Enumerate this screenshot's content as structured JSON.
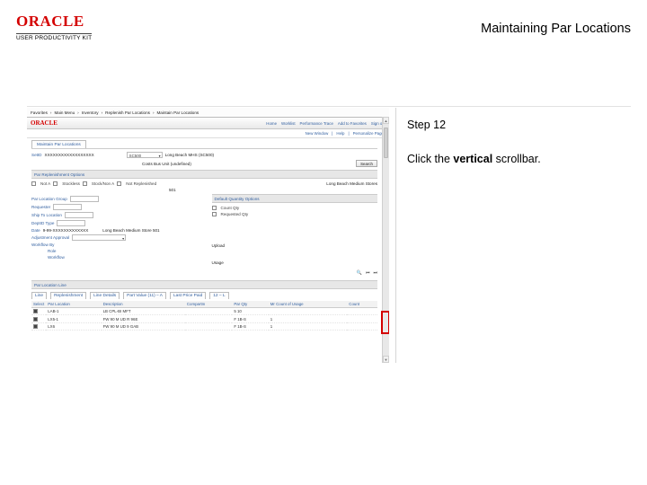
{
  "brand": {
    "logo_word": "ORACLE",
    "sub": "USER PRODUCTIVITY KIT"
  },
  "page_title": "Maintaining Par Locations",
  "instructions": {
    "step_label": "Step 12",
    "text_pre": "Click the ",
    "text_bold": "vertical",
    "text_post": " scrollbar."
  },
  "app": {
    "crumbs": [
      "Favorites",
      "Main Menu",
      "Inventory",
      "Replenish Par Locations",
      "Maintain Par Locations"
    ],
    "top_links": [
      "Home",
      "Worklist",
      "Performance Trace",
      "Add to Favorites",
      "Sign out"
    ],
    "mini_logo": "ORACLE",
    "nav3": [
      "New Window",
      "Help",
      "Personalize Page"
    ],
    "tab": "Maintain Par Locations",
    "header": {
      "setid_label": "SetID",
      "setid_value": "XXXXXXXXXXXXXXXXXX",
      "bu_label": "",
      "bu_value": "SC500",
      "bu_name": "Long Beach MHS (SC500)",
      "gl_label": "",
      "gl_value": "Costs Bus Unit (undefined)",
      "search_btn": "Search"
    },
    "repl_section": "Par Replenishment Options",
    "repl_opts": [
      "Not A",
      "Stockless",
      "Stock/Non A",
      "Not Replenished"
    ],
    "left": [
      {
        "label": "Par Location Group",
        "type": "inp",
        "value": ""
      },
      {
        "label": "Requester",
        "type": "inp",
        "value": ""
      },
      {
        "label": "Ship To Location",
        "type": "inp",
        "value": ""
      },
      {
        "label": "DeptID Type",
        "type": "inp",
        "value": ""
      },
      {
        "label": "Date",
        "type": "text",
        "value": "9-99-XXXXXXXXXXXXX"
      },
      {
        "label": "Adjustment Approval",
        "type": "selinp",
        "value": ""
      },
      {
        "label": "Workflow By",
        "type": "text",
        "value": ""
      },
      {
        "label": "Role",
        "type": "text",
        "value": ""
      },
      {
        "label": "Workflow",
        "type": "text",
        "value": ""
      }
    ],
    "left_extra_text1": "Long Beach Medium Stores",
    "left_extra_text2": "501",
    "left_extra_text3": "Long Beach Medium Store 501",
    "right_section": "Default Quantity Options",
    "right_opts": [
      "Count Qty",
      "Requested Qty"
    ],
    "right_mid1": "Upload",
    "right_mid2": "Usage",
    "line_section": "Par Location Line",
    "line_tabs": [
      "Line",
      "Replenishment",
      "Line Details",
      "Part Value (11) – A",
      "Last Price Paid",
      "12 – L"
    ],
    "table": {
      "cols": [
        "Select",
        "Par Location",
        "Description",
        "Compartm",
        "Par Qty",
        "Mr Count of Usage",
        "Count"
      ],
      "rows": [
        {
          "select": true,
          "loc": "LAB-1",
          "desc": "LB CPL-BI MFT",
          "comp": "",
          "par": "5 10",
          "mr": "",
          "cnt": ""
        },
        {
          "select": true,
          "loc": "LX5-1",
          "desc": "FW 90 M UD R 96E",
          "comp": "",
          "par": "F 1B-S",
          "mr": "1",
          "cnt": ""
        },
        {
          "select": true,
          "loc": "LX6",
          "desc": "FW 90 M UD 9 GAB",
          "comp": "",
          "par": "F 1B-S",
          "mr": "1",
          "cnt": ""
        }
      ]
    }
  }
}
